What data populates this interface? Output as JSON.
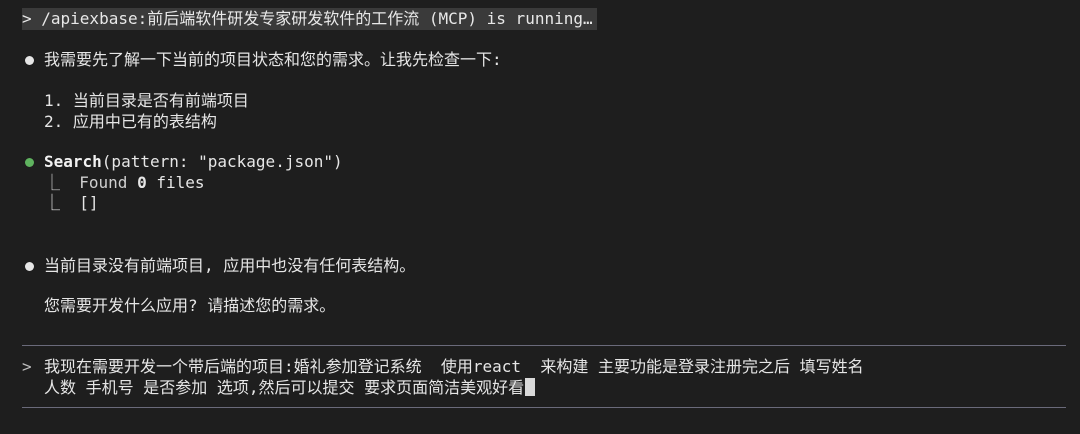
{
  "header": {
    "command": "> /apiexbase:前后端软件研发专家研发软件的工作流 (MCP) is running…"
  },
  "messages": {
    "intro": "我需要先了解一下当前的项目状态和您的需求。让我先检查一下:",
    "checklist": [
      "1. 当前目录是否有前端项目",
      "2. 应用中已有的表结构"
    ]
  },
  "tool_call": {
    "name": "Search",
    "args": "(pattern: \"package.json\")",
    "result_prefix": "⎿  Found ",
    "result_count": "0",
    "result_suffix": " files",
    "result_list": "⎿  []"
  },
  "reply": {
    "status": "当前目录没有前端项目, 应用中也没有任何表结构。",
    "question": "您需要开发什么应用? 请描述您的需求。"
  },
  "input": {
    "prompt": ">",
    "line1": "我现在需要开发一个带后端的项目:婚礼参加登记系统  使用react  来构建 主要功能是登录注册完之后 填写姓名",
    "line2": "人数 手机号 是否参加 选项,然后可以提交 要求页面简洁美观好看"
  }
}
